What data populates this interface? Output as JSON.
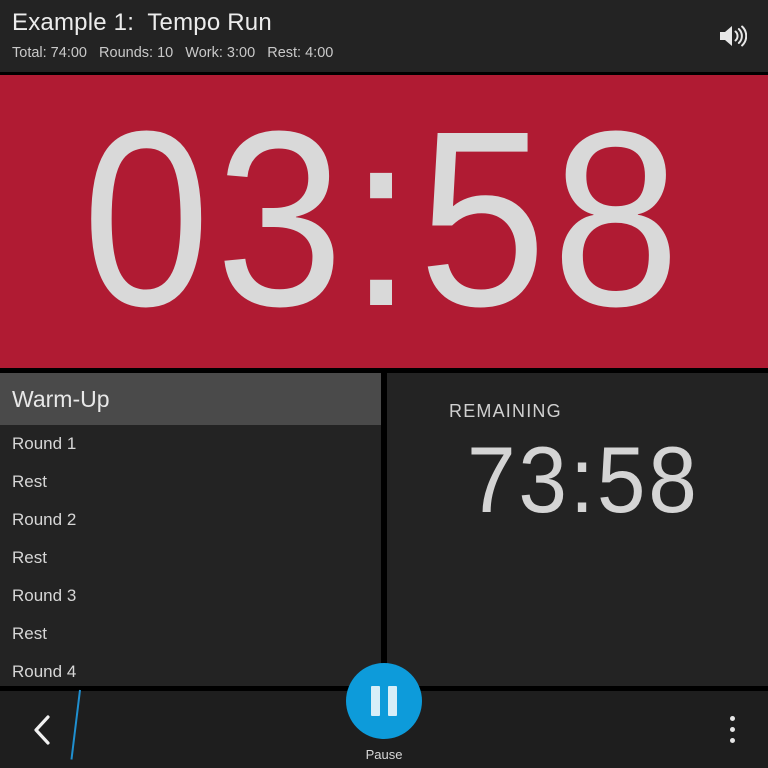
{
  "header": {
    "title": "Example 1:  Tempo Run",
    "stats": "Total: 74:00   Rounds: 10   Work: 3:00   Rest: 4:00",
    "speaker_icon": "volume-on-icon"
  },
  "timer": {
    "value": "03:58",
    "bg_color": "#b01b33",
    "text_color": "#d9d9d9"
  },
  "schedule": {
    "items": [
      {
        "label": "Warm-Up",
        "current": true
      },
      {
        "label": "Round 1",
        "current": false
      },
      {
        "label": "Rest",
        "current": false
      },
      {
        "label": "Round 2",
        "current": false
      },
      {
        "label": "Rest",
        "current": false
      },
      {
        "label": "Round 3",
        "current": false
      },
      {
        "label": "Rest",
        "current": false
      },
      {
        "label": "Round 4",
        "current": false
      }
    ]
  },
  "remaining": {
    "label": "REMAINING",
    "value": "73:58"
  },
  "bottom_bar": {
    "back_icon": "chevron-left-icon",
    "pause_label": "Pause",
    "pause_icon": "pause-icon",
    "pause_color": "#0d9bda",
    "overflow_icon": "more-vertical-icon"
  }
}
